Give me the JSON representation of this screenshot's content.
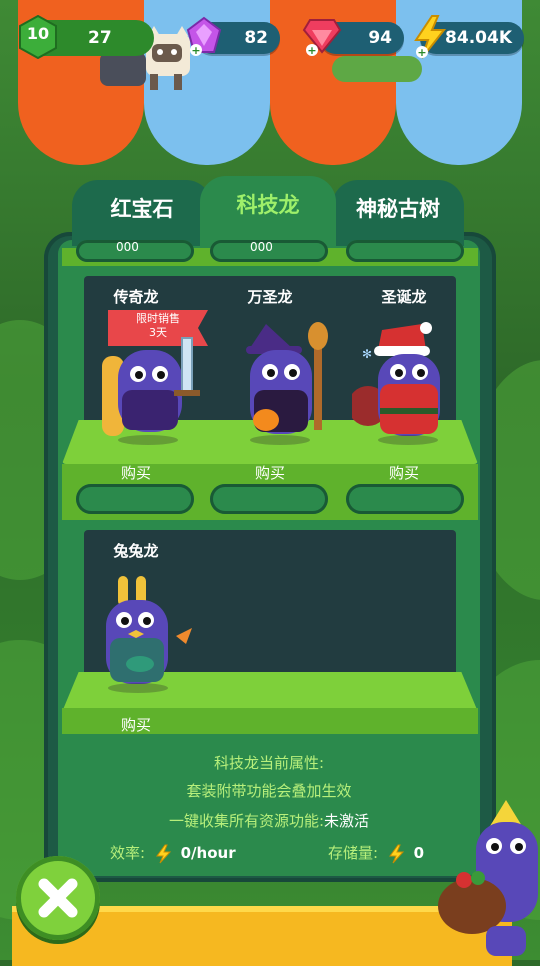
{
  "status_bar": {
    "level": "10",
    "xp": "27",
    "purple_gems": "82",
    "red_gems": "94",
    "energy": "84.04K"
  },
  "tabs": [
    {
      "label": "红宝石",
      "active": false
    },
    {
      "label": "科技龙",
      "active": true
    },
    {
      "label": "神秘古树",
      "active": false
    }
  ],
  "shelf_top_partial": {
    "price_1": "000",
    "price_2": "000"
  },
  "dragons": [
    {
      "name": "传奇龙",
      "badge_line1": "限时销售",
      "badge_line2": "3天",
      "buy_label": "购买"
    },
    {
      "name": "万圣龙",
      "buy_label": "购买"
    },
    {
      "name": "圣诞龙",
      "buy_label": "购买"
    },
    {
      "name": "兔兔龙",
      "buy_label": "购买"
    }
  ],
  "info": {
    "title": "科技龙当前属性:",
    "line1": "套装附带功能会叠加生效",
    "line2_label": "一键收集所有资源功能:",
    "line2_value": "未激活",
    "efficiency_label": "效率:",
    "efficiency_value": "0/hour",
    "storage_label": "存储量:",
    "storage_value": "0"
  },
  "colors": {
    "awning_orange": "#f0611f",
    "awning_blue": "#7cc0ee",
    "shelf_green": "#7ed03a",
    "badge_red": "#e8474a",
    "dragon_purple": "#5848b8"
  },
  "icons": {
    "level": "green-hexagon-icon",
    "purple_gem": "purple-gem-icon",
    "red_gem": "red-gem-icon",
    "energy": "lightning-icon",
    "close": "close-icon"
  }
}
